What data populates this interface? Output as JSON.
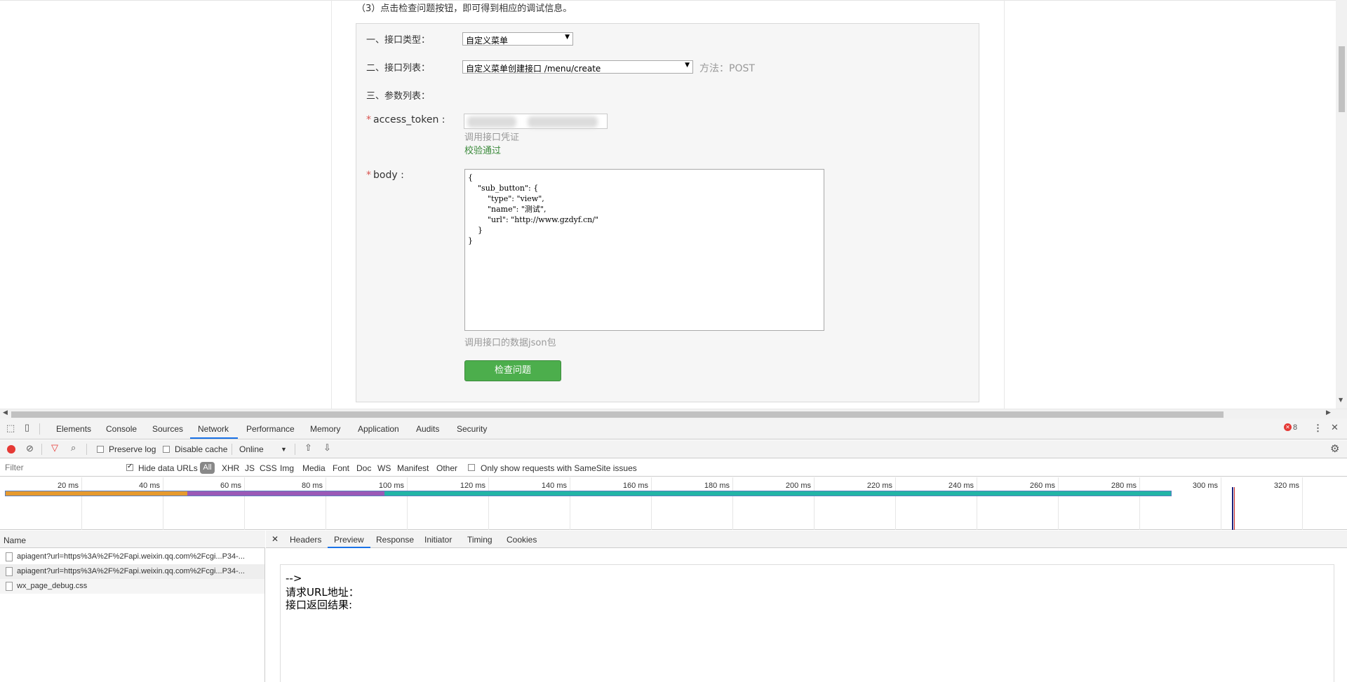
{
  "page": {
    "step_text": "（3）点击检查问题按钮，即可得到相应的调试信息。",
    "label_type": "一、接口类型：",
    "type_value": "自定义菜单",
    "label_list": "二、接口列表：",
    "list_value": "自定义菜单创建接口 /menu/create",
    "method_text": "方法：POST",
    "label_params": "三、参数列表：",
    "required_mark": "*",
    "label_token": "access_token :",
    "token_hint": "调用接口凭证",
    "token_status": "校验通过",
    "label_body": "body :",
    "body_value": "{\n    \"sub_button\": {\n        \"type\": \"view\",\n        \"name\": \"测试\",\n        \"url\": \"http://www.gzdyf.cn/\"\n    }\n}",
    "body_hint": "调用接口的数据json包",
    "check_button": "检查问题"
  },
  "devtools": {
    "tabs": [
      "Elements",
      "Console",
      "Sources",
      "Network",
      "Performance",
      "Memory",
      "Application",
      "Audits",
      "Security"
    ],
    "active_tab": "Network",
    "error_count": "8",
    "toolbar": {
      "preserve_log": "Preserve log",
      "disable_cache": "Disable cache",
      "throttle": "Online"
    },
    "filter": {
      "placeholder": "Filter",
      "hide_data_urls": "Hide data URLs",
      "all_chip": "All",
      "types": [
        "XHR",
        "JS",
        "CSS",
        "Img",
        "Media",
        "Font",
        "Doc",
        "WS",
        "Manifest",
        "Other"
      ],
      "samesite": "Only show requests with SameSite issues"
    },
    "timeline_ticks": [
      "20 ms",
      "40 ms",
      "60 ms",
      "80 ms",
      "100 ms",
      "120 ms",
      "140 ms",
      "160 ms",
      "180 ms",
      "200 ms",
      "220 ms",
      "240 ms",
      "260 ms",
      "280 ms",
      "300 ms",
      "320 ms"
    ],
    "request_list": {
      "header": "Name",
      "rows": [
        "apiagent?url=https%3A%2F%2Fapi.weixin.qq.com%2Fcgi...P34-...",
        "apiagent?url=https%3A%2F%2Fapi.weixin.qq.com%2Fcgi...P34-...",
        "wx_page_debug.css"
      ]
    },
    "detail_tabs": [
      "Headers",
      "Preview",
      "Response",
      "Initiator",
      "Timing",
      "Cookies"
    ],
    "active_detail_tab": "Preview",
    "preview_lines": [
      "-->",
      "请求URL地址：",
      "接口返回结果:"
    ]
  }
}
